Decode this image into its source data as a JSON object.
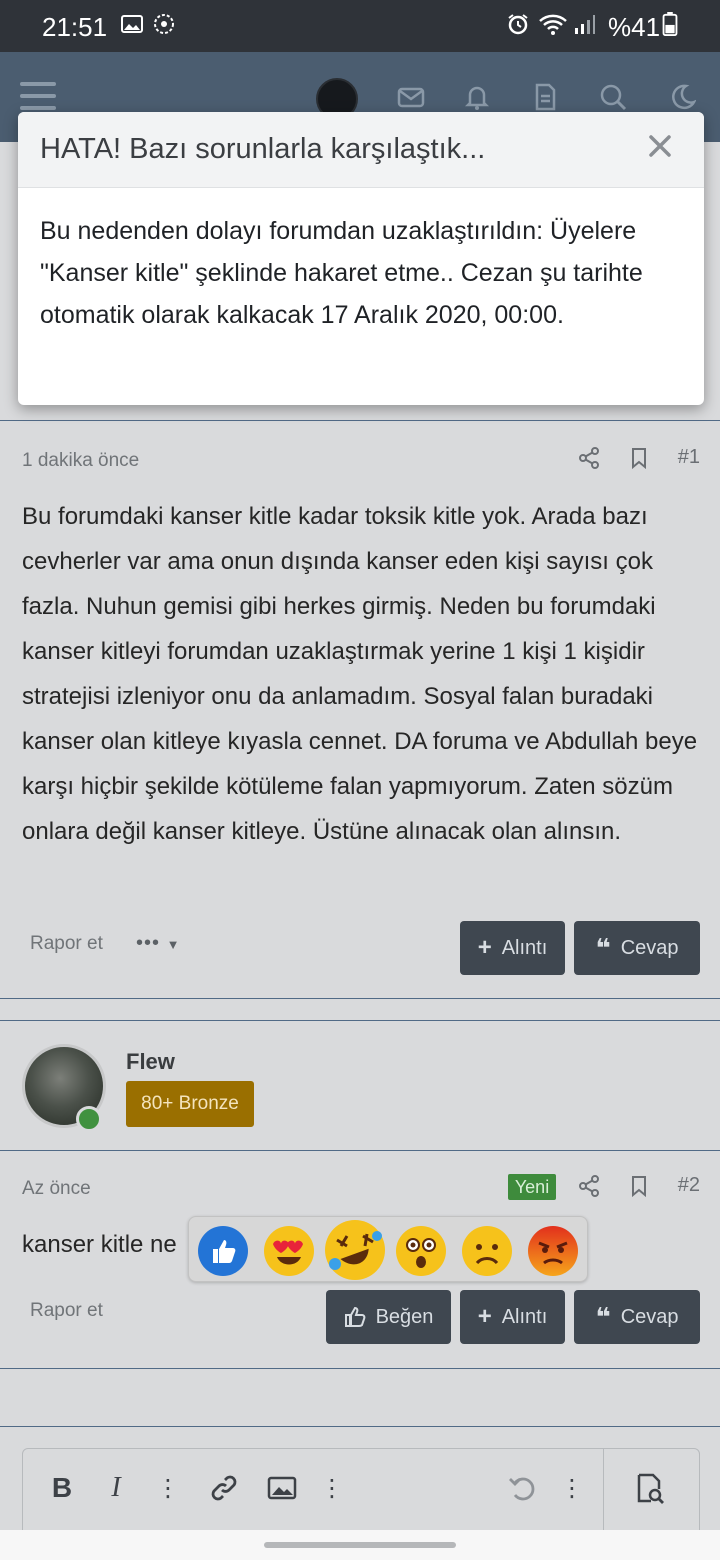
{
  "status_bar": {
    "time": "21:51",
    "battery": "%41"
  },
  "modal": {
    "title": "HATA! Bazı sorunlarla karşılaştık...",
    "message": "Bu nedenden dolayı forumdan uzaklaştırıldın: Üyelere \"Kanser kitle\" şeklinde hakaret etme.. Cezan şu tarihte otomatik olarak kalkacak 17 Aralık 2020, 00:00."
  },
  "post1": {
    "time": "1 dakika önce",
    "number": "#1",
    "text": "Bu forumdaki kanser kitle kadar toksik kitle yok. Arada bazı cevherler var ama onun dışında kanser eden kişi sayısı çok fazla. Nuhun gemisi gibi herkes girmiş. Neden bu forumdaki kanser kitleyi forumdan uzaklaştırmak yerine 1 kişi 1 kişidir stratejisi izleniyor onu da anlamadım. Sosyal falan buradaki kanser olan kitleye kıyasla cennet. DA foruma ve Abdullah beye karşı hiçbir şekilde kötüleme falan yapmıyorum. Zaten sözüm onlara değil kanser kitleye. Üstüne alınacak olan alınsın.",
    "report": "Rapor et",
    "more": "•••",
    "quote": "Alıntı",
    "reply": "Cevap"
  },
  "post2": {
    "username": "Flew",
    "rank": "80+ Bronze",
    "time": "Az önce",
    "badge": "Yeni",
    "number": "#2",
    "text": "kanser kitle ne",
    "report": "Rapor et",
    "like": "Beğen",
    "quote": "Alıntı",
    "reply": "Cevap"
  }
}
